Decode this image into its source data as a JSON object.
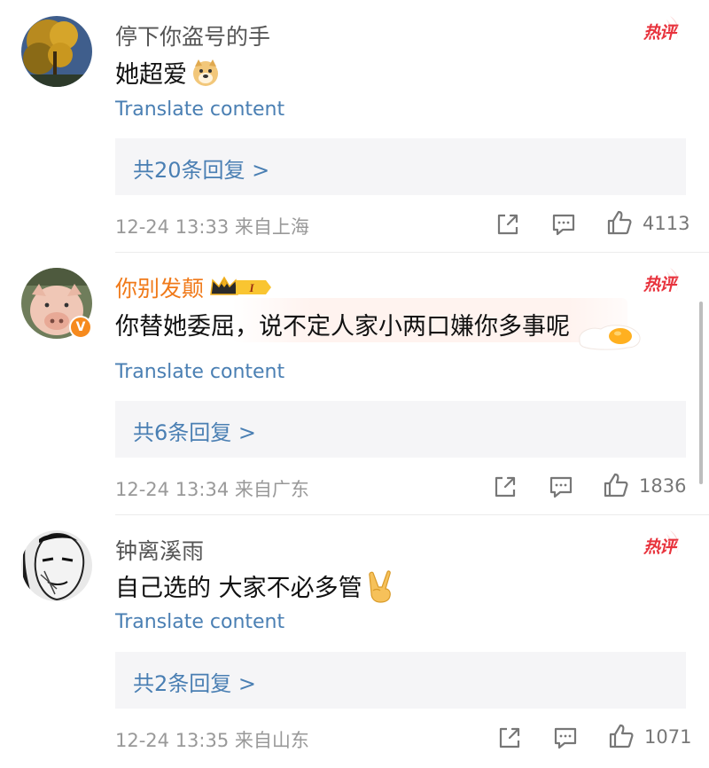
{
  "comments": [
    {
      "username": "停下你盗号的手",
      "text": "她超爱",
      "text_emoji": "doge-emoji",
      "translate": "Translate content",
      "replies": "共20条回复 >",
      "time": "12-24 13:33",
      "location": "来自上海",
      "likes": "4113",
      "hot": "热评"
    },
    {
      "username": "你别发颠",
      "text": "你替她委屈，说不定人家小两口嫌你多事呢",
      "text_decoration": "fried-egg-decoration",
      "translate": "Translate content",
      "replies": "共6条回复 >",
      "time": "12-24 13:34",
      "location": "来自广东",
      "likes": "1836",
      "hot": "热评",
      "vip_level": "I",
      "verified": "V"
    },
    {
      "username": "钟离溪雨",
      "text": "自己选的 大家不必多管",
      "text_emoji": "victory-hand-emoji",
      "translate": "Translate content",
      "replies": "共2条回复 >",
      "time": "12-24 13:35",
      "location": "来自山东",
      "likes": "1071",
      "hot": "热评"
    }
  ],
  "colors": {
    "link": "#4a7fb3",
    "hot": "#e8333d",
    "vip_name": "#f07a1a",
    "reply_bg": "#f5f5f7"
  }
}
